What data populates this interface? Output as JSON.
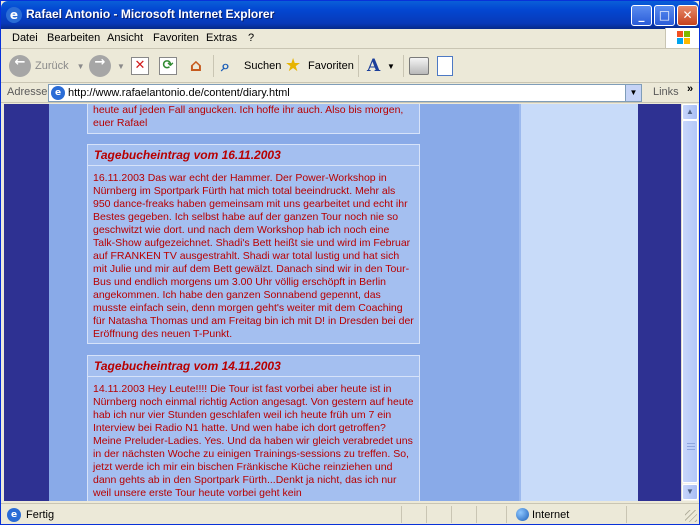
{
  "window": {
    "title": "Rafael Antonio - Microsoft Internet Explorer",
    "min_glyph": "_",
    "max_glyph": "□",
    "close_glyph": "✕"
  },
  "menu": {
    "items": [
      "Datei",
      "Bearbeiten",
      "Ansicht",
      "Favoriten",
      "Extras",
      "?"
    ]
  },
  "toolbar": {
    "back_label": "Zurück",
    "search_label": "Suchen",
    "favorites_label": "Favoriten"
  },
  "address": {
    "label": "Adresse",
    "url": "http://www.rafaelantonio.de/content/diary.html",
    "links_label": "Links",
    "links_chevron": "»"
  },
  "page": {
    "partial_entry_text": "heute auf jeden Fall angucken. Ich hoffe ihr auch. Also bis morgen, euer Rafael",
    "entries": [
      {
        "title": "Tagebucheintrag vom 16.11.2003",
        "body": "16.11.2003 Das war echt der Hammer. Der Power-Workshop in Nürnberg im Sportpark Fürth hat mich total beeindruckt. Mehr als 950 dance-freaks haben gemeinsam mit uns gearbeitet und echt ihr Bestes gegeben. Ich selbst habe auf der ganzen Tour noch nie so geschwitzt wie dort. und nach dem Workshop hab ich noch eine Talk-Show aufgezeichnet. Shadi's Bett heißt sie und wird im Februar auf FRANKEN TV ausgestrahlt. Shadi war total lustig und hat sich mit Julie und mir auf dem Bett gewälzt. Danach sind wir in den Tour-Bus und endlich morgens um 3.00 Uhr völlig erschöpft in Berlin angekommen. Ich habe den ganzen Sonnabend gepennt, das musste einfach sein, denn morgen geht's weiter mit dem Coaching für Natasha Thomas und am Freitag bin ich mit D! in Dresden bei der Eröffnung des neuen T-Punkt."
      },
      {
        "title": "Tagebucheintrag vom 14.11.2003",
        "body": "14.11.2003 Hey Leute!!!! Die Tour ist fast vorbei aber heute ist in Nürnberg noch einmal richtig Action angesagt. Von gestern auf heute hab ich nur vier Stunden geschlafen weil ich heute früh um 7 ein Interview bei Radio N1 hatte. Und wen habe ich dort getroffen? Meine Preluder-Ladies. Yes. Und da haben wir gleich verabredet uns in der nächsten Woche zu einigen Trainings-sessions zu treffen. So, jetzt werde ich mir ein bischen Fränkische Küche reinziehen und dann gehts ab in den Sportpark Fürth...Denkt ja nicht, das ich nur weil unsere erste Tour heute vorbei geht kein"
      }
    ]
  },
  "status": {
    "text": "Fertig",
    "zone": "Internet"
  },
  "colors": {
    "page_outer": "#2e3192",
    "page_panel": "#89aae8",
    "entry_text": "#b80000"
  }
}
